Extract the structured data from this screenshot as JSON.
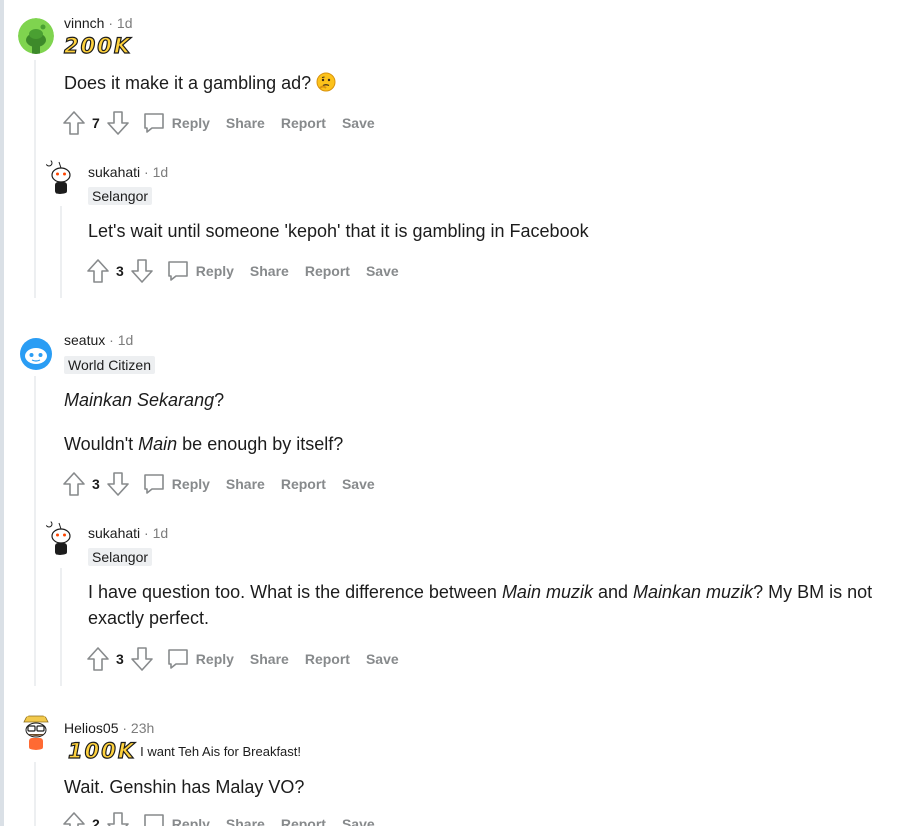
{
  "colors": {
    "award_gold": "#ffd23d",
    "meta_gray": "#7c7c7c",
    "action_gray": "#878a8c",
    "flair_bg": "#edeff1"
  },
  "actions": {
    "reply": "Reply",
    "share": "Share",
    "report": "Report",
    "save": "Save"
  },
  "comments": [
    {
      "username": "vinnch",
      "meta": "· 1d",
      "avatar_icon": "green-snoo-avatar",
      "award_text": "200K",
      "body": "Does it make it a gambling ad?",
      "emoji": "thinking-face-emoji",
      "score": "7"
    },
    {
      "username": "sukahati",
      "meta": "· 1d",
      "avatar_icon": "white-snoo-avatar",
      "flair": "Selangor",
      "body": "Let's wait until someone 'kepoh' that it is gambling in Facebook",
      "score": "3"
    },
    {
      "username": "seatux",
      "meta": "· 1d",
      "avatar_icon": "blue-snoo-avatar",
      "flair": "World Citizen",
      "body_p1_italic": "Mainkan Sekarang",
      "body_p1_rest": "?",
      "body_p2_a": "Wouldn't ",
      "body_p2_italic": "Main",
      "body_p2_b": " be enough by itself?",
      "score": "3"
    },
    {
      "username": "sukahati",
      "meta": "· 1d",
      "avatar_icon": "white-snoo-avatar",
      "flair": "Selangor",
      "body_a": "I have question too. What is the difference between ",
      "body_i1": "Main muzik",
      "body_b": " and ",
      "body_i2": "Mainkan muzik",
      "body_c": "? My BM is not exactly perfect.",
      "score": "3"
    },
    {
      "username": "Helios05",
      "meta": "· 23h",
      "avatar_icon": "glasses-snoo-avatar",
      "award_text": "100K",
      "flair_note": "I want Teh Ais for Breakfast!",
      "body": "Wait. Genshin has Malay VO?",
      "score": "2"
    }
  ]
}
